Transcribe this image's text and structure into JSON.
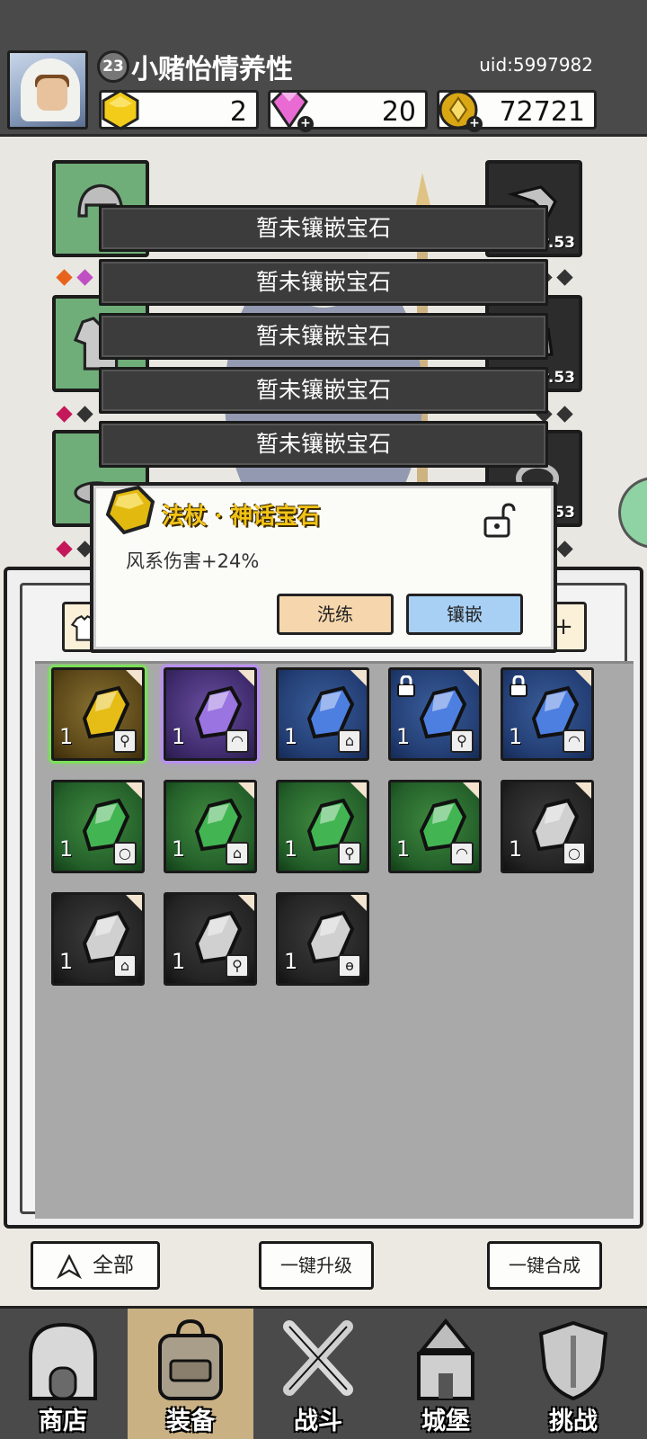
{
  "player": {
    "level": "23",
    "name": "小赌怡情养性",
    "uid": "uid:5997982"
  },
  "currencies": [
    {
      "icon": "gold-gem-icon",
      "value": "2"
    },
    {
      "icon": "diamond-icon",
      "value": "20"
    },
    {
      "icon": "coin-icon",
      "value": "72721"
    }
  ],
  "equipment": {
    "right_levels": [
      "Lv.53",
      "Lv.53",
      "Lv.53"
    ]
  },
  "sockets": [
    "暂未镶嵌宝石",
    "暂未镶嵌宝石",
    "暂未镶嵌宝石",
    "暂未镶嵌宝石",
    "暂未镶嵌宝石"
  ],
  "gem_popup": {
    "title": "法杖 · 神话宝石",
    "description": "风系伤害+24%",
    "refine_label": "洗练",
    "inlay_label": "镶嵌"
  },
  "inventory": {
    "items": [
      {
        "color": "gold",
        "count": "1",
        "type": "wand",
        "locked": false,
        "selected": "green"
      },
      {
        "color": "purple",
        "count": "1",
        "type": "hat",
        "locked": false,
        "selected": "purple"
      },
      {
        "color": "blue",
        "count": "1",
        "type": "armor",
        "locked": false,
        "selected": ""
      },
      {
        "color": "blue",
        "count": "1",
        "type": "wand",
        "locked": true,
        "selected": ""
      },
      {
        "color": "blue",
        "count": "1",
        "type": "hat",
        "locked": true,
        "selected": ""
      },
      {
        "color": "green",
        "count": "1",
        "type": "ring",
        "locked": false,
        "selected": ""
      },
      {
        "color": "green",
        "count": "1",
        "type": "armor",
        "locked": false,
        "selected": ""
      },
      {
        "color": "green",
        "count": "1",
        "type": "wand",
        "locked": false,
        "selected": ""
      },
      {
        "color": "green",
        "count": "1",
        "type": "hat",
        "locked": false,
        "selected": ""
      },
      {
        "color": "black",
        "count": "1",
        "type": "ring",
        "locked": false,
        "selected": ""
      },
      {
        "color": "black",
        "count": "1",
        "type": "armor",
        "locked": false,
        "selected": ""
      },
      {
        "color": "black",
        "count": "1",
        "type": "wand",
        "locked": false,
        "selected": ""
      },
      {
        "color": "black",
        "count": "1",
        "type": "necklace",
        "locked": false,
        "selected": ""
      }
    ]
  },
  "actions": {
    "filter_label": "全部",
    "upgrade_all_label": "一键升级",
    "merge_all_label": "一键合成"
  },
  "tabs": [
    {
      "label": "商店",
      "icon": "shop-icon"
    },
    {
      "label": "装备",
      "icon": "backpack-icon",
      "active": true
    },
    {
      "label": "战斗",
      "icon": "crossed-swords-icon"
    },
    {
      "label": "城堡",
      "icon": "castle-icon"
    },
    {
      "label": "挑战",
      "icon": "shield-icon"
    }
  ],
  "colors": {
    "header_bg": "#4a4a4a",
    "title_gold": "#f2c315",
    "refine_btn": "#f6d6ad",
    "inlay_btn": "#a8d0f5",
    "active_tab": "#c9b184"
  }
}
